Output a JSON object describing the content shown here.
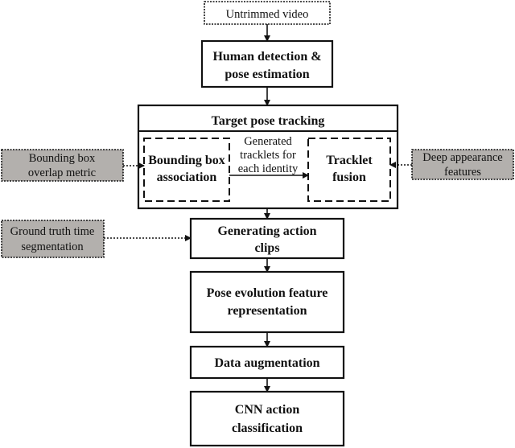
{
  "diagram": {
    "type": "flowchart",
    "colors": {
      "input_box_fill_gray": "#b3b0ad",
      "stroke": "#111111",
      "background": "#ffffff"
    },
    "nodes": {
      "untrimmed_video": {
        "lines": [
          "Untrimmed video"
        ],
        "style": "dotted-border input"
      },
      "human_detection": {
        "lines": [
          "Human detection &",
          "pose estimation"
        ],
        "style": "solid"
      },
      "target_pose_tracking": {
        "title": "Target pose tracking",
        "style": "solid container"
      },
      "bbox_association": {
        "lines": [
          "Bounding box",
          "association"
        ],
        "style": "dashed"
      },
      "tracklet_fusion": {
        "lines": [
          "Tracklet",
          "fusion"
        ],
        "style": "dashed"
      },
      "generating_clips": {
        "lines": [
          "Generating action",
          "clips"
        ],
        "style": "solid"
      },
      "pose_evolution": {
        "lines": [
          "Pose evolution feature",
          "representation"
        ],
        "style": "solid"
      },
      "data_augmentation": {
        "lines": [
          "Data augmentation"
        ],
        "style": "solid"
      },
      "cnn_classification": {
        "lines": [
          "CNN action",
          "classification"
        ],
        "style": "solid"
      },
      "bbox_overlap_metric": {
        "lines": [
          "Bounding box",
          "overlap metric"
        ],
        "style": "dotted-border gray input"
      },
      "deep_appearance": {
        "lines": [
          "Deep appearance",
          "features"
        ],
        "style": "dotted-border gray input"
      },
      "ground_truth_segmentation": {
        "lines": [
          "Ground truth time",
          "segmentation"
        ],
        "style": "dotted-border gray input"
      }
    },
    "edge_labels": {
      "tracklets": [
        "Generated",
        "tracklets for",
        "each identity"
      ]
    },
    "edges": [
      {
        "from": "untrimmed_video",
        "to": "human_detection",
        "style": "solid"
      },
      {
        "from": "human_detection",
        "to": "target_pose_tracking",
        "style": "solid"
      },
      {
        "from": "bbox_association",
        "to": "tracklet_fusion",
        "style": "solid",
        "label": "Generated tracklets for each identity"
      },
      {
        "from": "bbox_overlap_metric",
        "to": "bbox_association",
        "style": "dotted"
      },
      {
        "from": "deep_appearance",
        "to": "tracklet_fusion",
        "style": "dotted"
      },
      {
        "from": "target_pose_tracking",
        "to": "generating_clips",
        "style": "solid"
      },
      {
        "from": "ground_truth_segmentation",
        "to": "generating_clips",
        "style": "dotted"
      },
      {
        "from": "generating_clips",
        "to": "pose_evolution",
        "style": "solid"
      },
      {
        "from": "pose_evolution",
        "to": "data_augmentation",
        "style": "solid"
      },
      {
        "from": "data_augmentation",
        "to": "cnn_classification",
        "style": "solid"
      }
    ]
  }
}
